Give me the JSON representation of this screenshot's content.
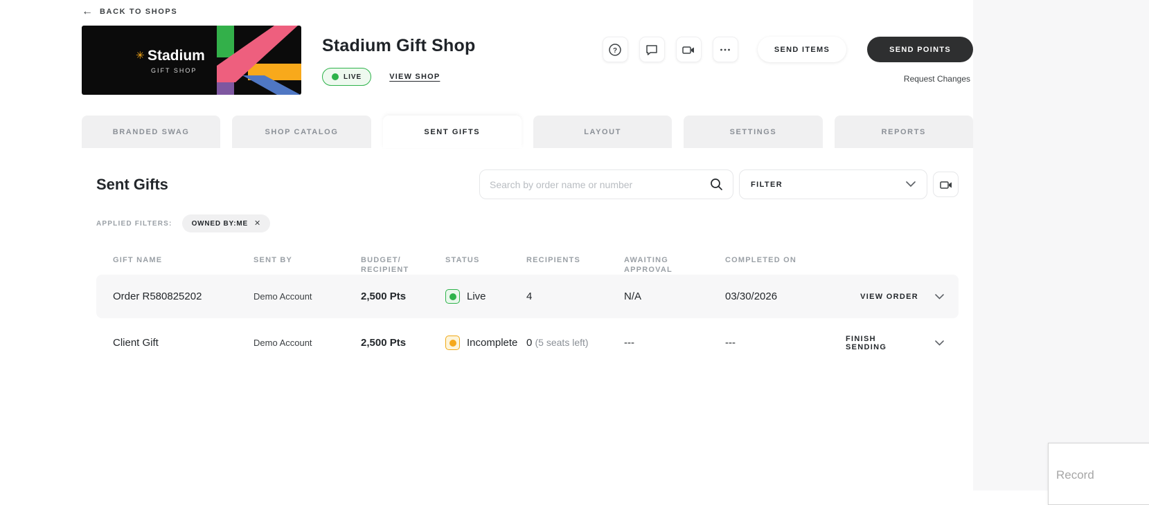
{
  "page": {
    "back_link": "BACK TO SHOPS",
    "record_button": "Record"
  },
  "header": {
    "title": "Stadium Gift Shop",
    "live_badge": "LIVE",
    "view_shop": "VIEW SHOP",
    "banner": {
      "brand": "Stadium",
      "tagline": "GIFT SHOP"
    },
    "send_items": "SEND ITEMS",
    "send_points": "SEND POINTS",
    "request_changes": "Request Changes",
    "icons": [
      "help-icon",
      "chat-icon",
      "video-icon",
      "more-icon"
    ]
  },
  "tabs": [
    {
      "label": "BRANDED SWAG",
      "active": false
    },
    {
      "label": "SHOP CATALOG",
      "active": false
    },
    {
      "label": "SENT GIFTS",
      "active": true
    },
    {
      "label": "LAYOUT",
      "active": false
    },
    {
      "label": "SETTINGS",
      "active": false
    },
    {
      "label": "REPORTS",
      "active": false
    }
  ],
  "content": {
    "heading": "Sent Gifts",
    "search_placeholder": "Search by order name or number",
    "filter_label": "FILTER",
    "applied_filters_label": "APPLIED FILTERS:",
    "filter_chip": "OWNED BY:ME"
  },
  "table": {
    "columns": [
      [
        "GIFT NAME"
      ],
      [
        "SENT BY"
      ],
      [
        "BUDGET/",
        "RECIPIENT"
      ],
      [
        "STATUS"
      ],
      [
        "RECIPIENTS"
      ],
      [
        "AWAITING",
        "APPROVAL"
      ],
      [
        "COMPLETED ON"
      ]
    ],
    "rows": [
      {
        "gift_name": "Order R580825202",
        "sent_by": "Demo Account",
        "budget": "2,500 Pts",
        "status": "Live",
        "status_color": "green",
        "recipients": "4",
        "recipients_note": "",
        "awaiting_approval": "N/A",
        "completed_on": "03/30/2026",
        "action": "VIEW ORDER"
      },
      {
        "gift_name": "Client Gift",
        "sent_by": "Demo Account",
        "budget": "2,500 Pts",
        "status": "Incomplete",
        "status_color": "amber",
        "recipients": "0",
        "recipients_note": "(5 seats left)",
        "awaiting_approval": "---",
        "completed_on": "---",
        "action": "FINISH SENDING"
      }
    ]
  },
  "colors": {
    "live_green": "#2db24a",
    "incomplete_amber": "#f5a81c",
    "dark_button": "#2e2f30",
    "logo_green": "#33b04a",
    "logo_pink": "#ee5f7e",
    "logo_yellow": "#f8a91b",
    "logo_blue": "#4f77c3",
    "logo_purple": "#7e57a0"
  }
}
